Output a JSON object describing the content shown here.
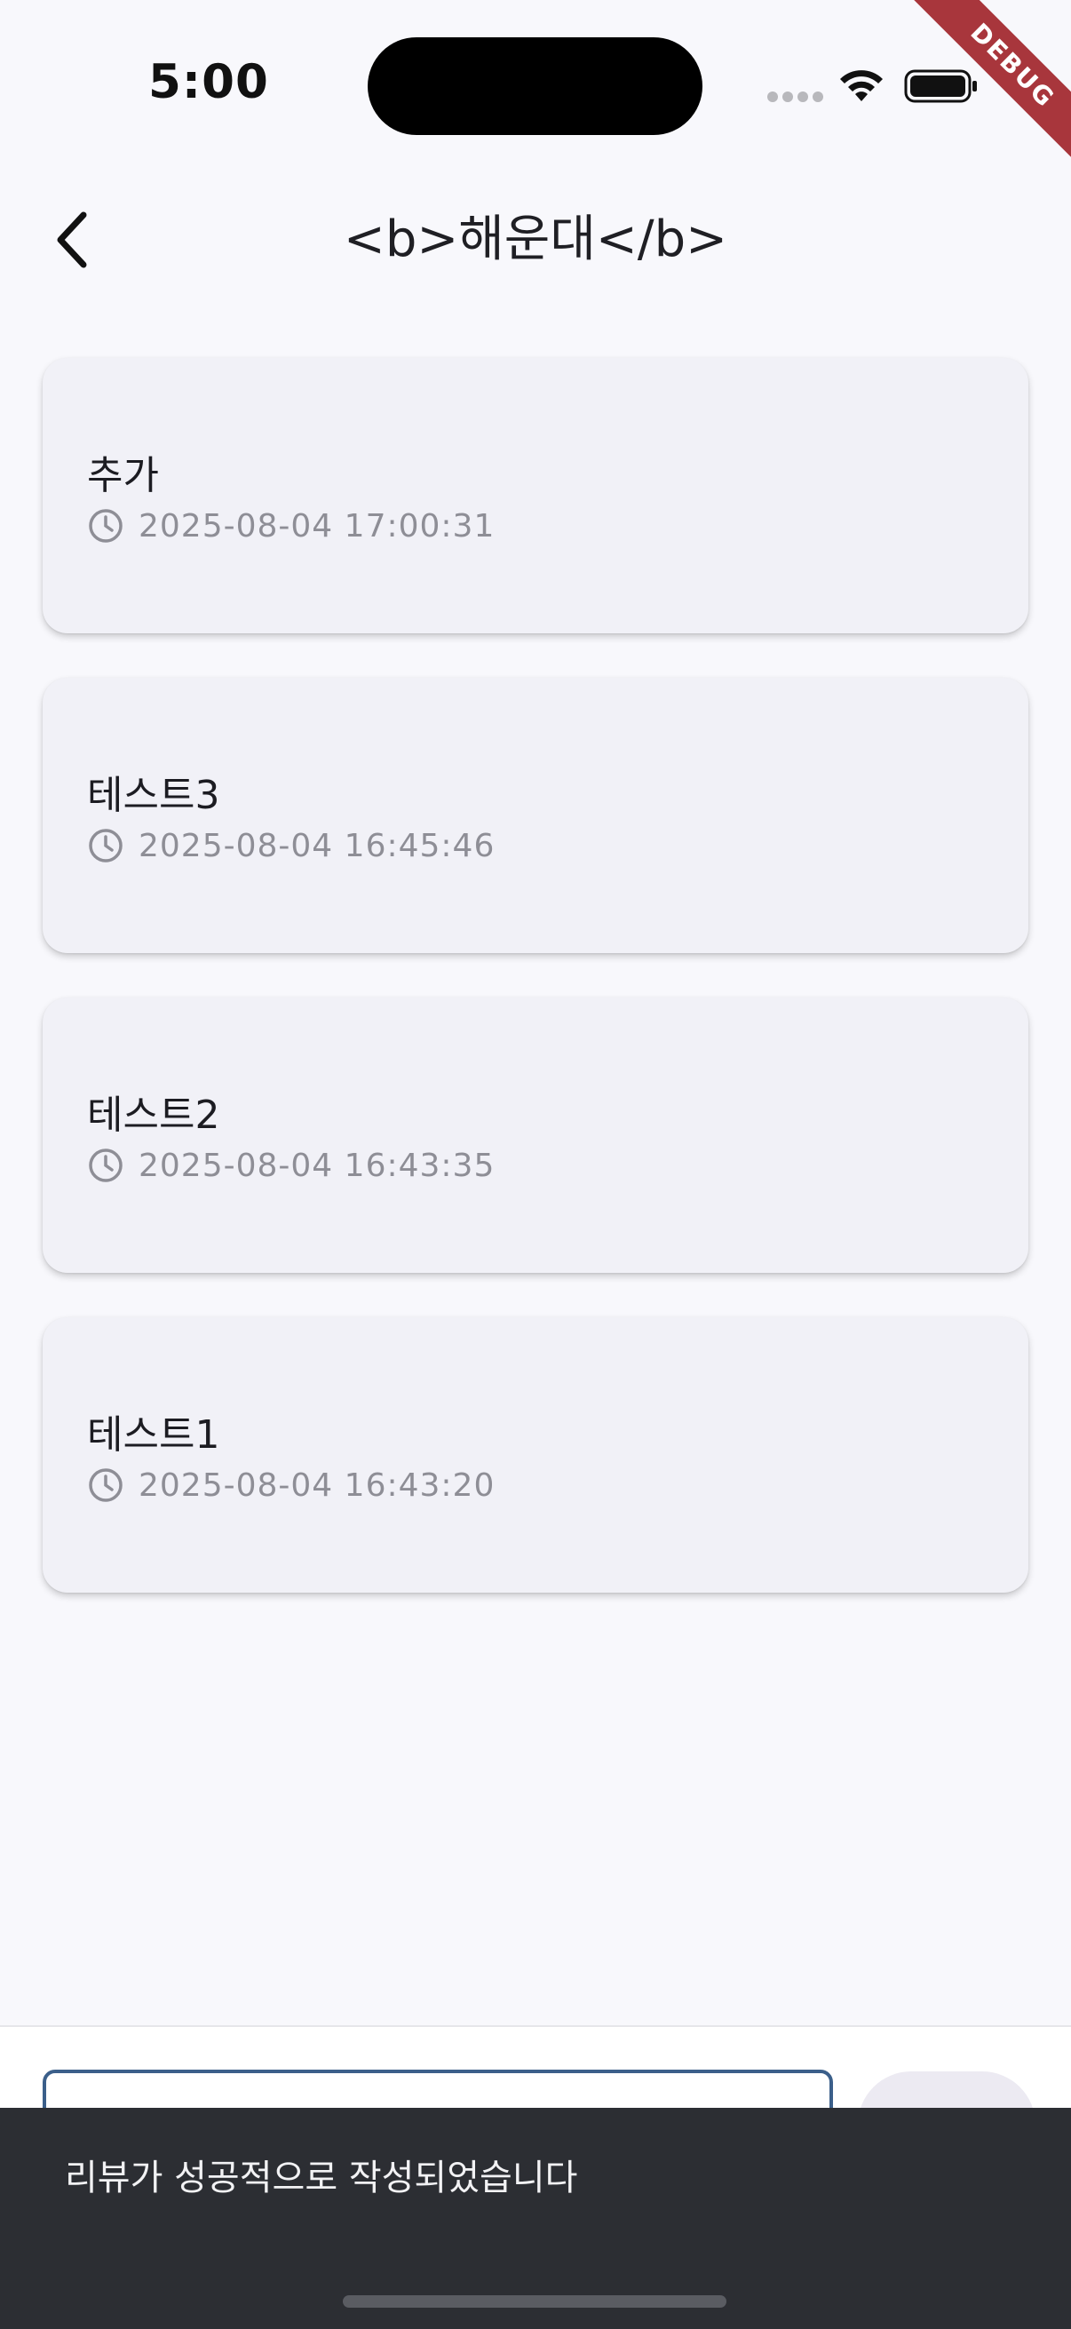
{
  "status_bar": {
    "time": "5:00",
    "debug_label": "DEBUG"
  },
  "header": {
    "title": "<b>해운대</b>",
    "back_icon": "chevron-left-icon"
  },
  "reviews": [
    {
      "title": "추가",
      "datetime": "2025-08-04 17:00:31"
    },
    {
      "title": "테스트3",
      "datetime": "2025-08-04 16:45:46"
    },
    {
      "title": "테스트2",
      "datetime": "2025-08-04 16:43:35"
    },
    {
      "title": "테스트1",
      "datetime": "2025-08-04 16:43:20"
    }
  ],
  "input": {
    "value": ""
  },
  "snackbar": {
    "message": "리뷰가 성공적으로 작성되었습니다"
  },
  "colors": {
    "background": "#f8f8fc",
    "card": "#f1f1f7",
    "input_border": "#3b5f8a",
    "snackbar": "#2c2e33",
    "debug_ribbon": "#a8363c"
  }
}
